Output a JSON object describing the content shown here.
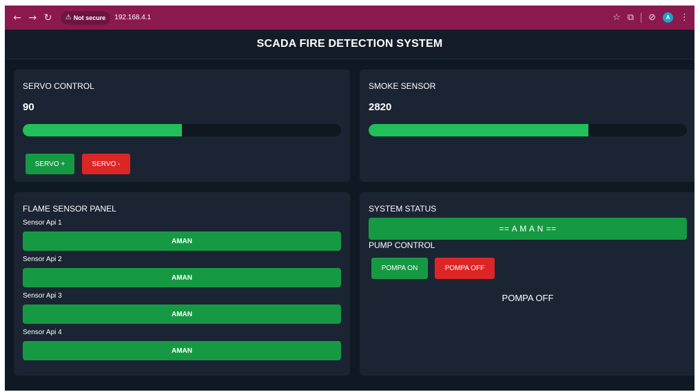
{
  "browser": {
    "security_label": "Not secure",
    "url": "192.168.4.1",
    "profile_initial": "A"
  },
  "header": {
    "title": "SCADA FIRE DETECTION SYSTEM"
  },
  "servo": {
    "title": "SERVO CONTROL",
    "value": "90",
    "level_fraction": 0.5,
    "plus_label": "SERVO +",
    "minus_label": "SERVO -"
  },
  "smoke": {
    "title": "SMOKE SENSOR",
    "value": "2820",
    "level_fraction": 0.69
  },
  "flame": {
    "title": "FLAME SENSOR PANEL",
    "sensors": [
      {
        "label": "Sensor Api 1",
        "status": "AMAN"
      },
      {
        "label": "Sensor Api 2",
        "status": "AMAN"
      },
      {
        "label": "Sensor Api 3",
        "status": "AMAN"
      },
      {
        "label": "Sensor Api 4",
        "status": "AMAN"
      }
    ]
  },
  "system": {
    "title": "SYSTEM STATUS",
    "status": "== A M A N ==",
    "pump_title": "PUMP CONTROL",
    "pump_on_label": "POMPA ON",
    "pump_off_label": "POMPA OFF",
    "pump_state": "POMPA OFF"
  },
  "colors": {
    "ok_green": "#169943",
    "bar_green": "#22c05b",
    "alert_red": "#dc2626",
    "card_bg": "#1b2433",
    "page_bg": "#0f1923",
    "chrome_bg": "#8a1a4e"
  }
}
